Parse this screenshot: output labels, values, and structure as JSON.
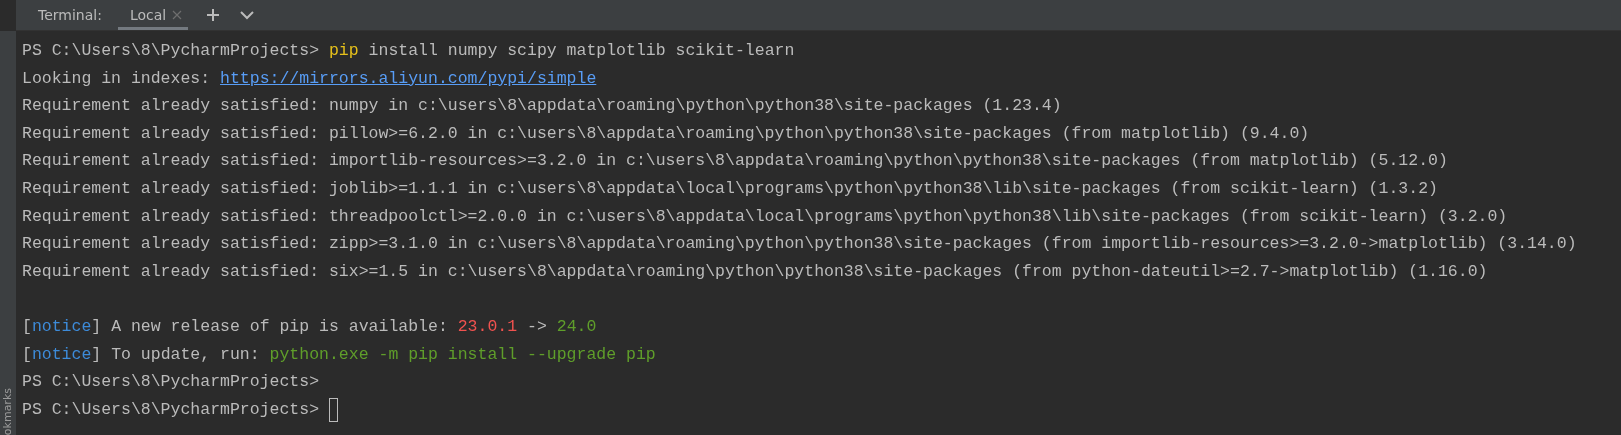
{
  "tool_window": {
    "title": "Terminal:",
    "tabs": [
      {
        "label": "Local",
        "selected": true
      }
    ]
  },
  "side_strip": {
    "label": "okmarks"
  },
  "terminal": {
    "lines": [
      [
        {
          "kind": "plain",
          "text": "PS C:\\Users\\8\\PycharmProjects> "
        },
        {
          "kind": "command",
          "text": "pip"
        },
        {
          "kind": "plain",
          "text": " install numpy scipy matplotlib scikit-learn"
        }
      ],
      [
        {
          "kind": "plain",
          "text": "Looking in indexes: "
        },
        {
          "kind": "link",
          "text": "https://mirrors.aliyun.com/pypi/simple"
        }
      ],
      [
        {
          "kind": "plain",
          "text": "Requirement already satisfied: numpy in c:\\users\\8\\appdata\\roaming\\python\\python38\\site-packages (1.23.4)"
        }
      ],
      [
        {
          "kind": "plain",
          "text": "Requirement already satisfied: pillow>=6.2.0 in c:\\users\\8\\appdata\\roaming\\python\\python38\\site-packages (from matplotlib) (9.4.0)"
        }
      ],
      [
        {
          "kind": "plain",
          "text": "Requirement already satisfied: importlib-resources>=3.2.0 in c:\\users\\8\\appdata\\roaming\\python\\python38\\site-packages (from matplotlib) (5.12.0)"
        }
      ],
      [
        {
          "kind": "plain",
          "text": "Requirement already satisfied: joblib>=1.1.1 in c:\\users\\8\\appdata\\local\\programs\\python\\python38\\lib\\site-packages (from scikit-learn) (1.3.2)"
        }
      ],
      [
        {
          "kind": "plain",
          "text": "Requirement already satisfied: threadpoolctl>=2.0.0 in c:\\users\\8\\appdata\\local\\programs\\python\\python38\\lib\\site-packages (from scikit-learn) (3.2.0)"
        }
      ],
      [
        {
          "kind": "plain",
          "text": "Requirement already satisfied: zipp>=3.1.0 in c:\\users\\8\\appdata\\roaming\\python\\python38\\site-packages (from importlib-resources>=3.2.0->matplotlib) (3.14.0)"
        }
      ],
      [
        {
          "kind": "plain",
          "text": "Requirement already satisfied: six>=1.5 in c:\\users\\8\\appdata\\roaming\\python\\python38\\site-packages (from python-dateutil>=2.7->matplotlib) (1.16.0)"
        }
      ],
      [
        {
          "kind": "blank_before"
        },
        {
          "kind": "plain",
          "text": "["
        },
        {
          "kind": "notice",
          "text": "notice"
        },
        {
          "kind": "plain",
          "text": "] A new release of pip is available: "
        },
        {
          "kind": "error",
          "text": "23.0.1"
        },
        {
          "kind": "plain",
          "text": " -> "
        },
        {
          "kind": "success",
          "text": "24.0"
        }
      ],
      [
        {
          "kind": "plain",
          "text": "["
        },
        {
          "kind": "notice",
          "text": "notice"
        },
        {
          "kind": "plain",
          "text": "] To update, run: "
        },
        {
          "kind": "success",
          "text": "python.exe -m pip install --upgrade pip"
        }
      ],
      [
        {
          "kind": "plain",
          "text": "PS C:\\Users\\8\\PycharmProjects>"
        }
      ],
      [
        {
          "kind": "plain",
          "text": "PS C:\\Users\\8\\PycharmProjects> "
        }
      ]
    ],
    "cursor": true
  }
}
